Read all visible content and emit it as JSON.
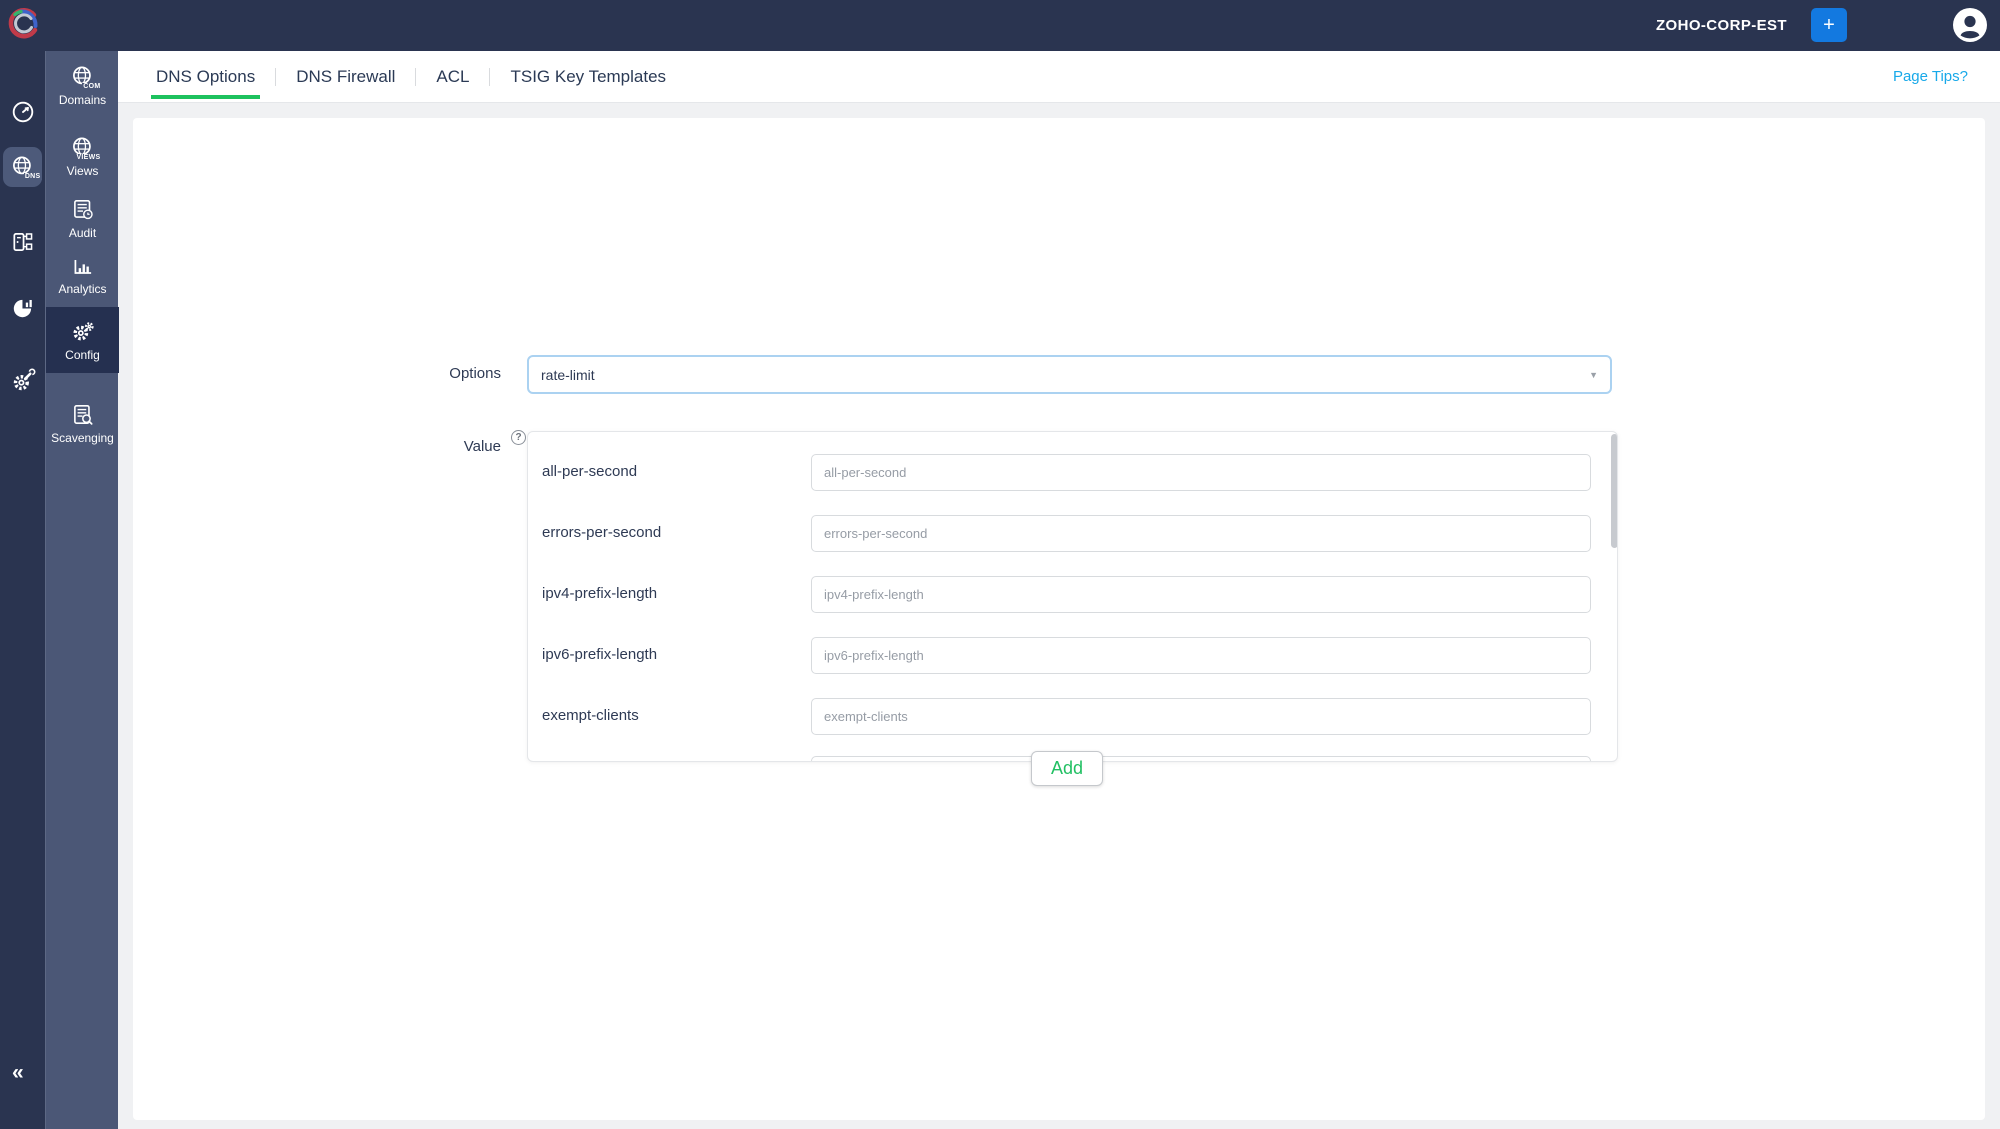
{
  "topbar": {
    "org_name": "ZOHO-CORP-EST",
    "add_label": "+"
  },
  "tab_bar": {
    "tabs": [
      {
        "label": "DNS Options",
        "active": true
      },
      {
        "label": "DNS Firewall",
        "active": false
      },
      {
        "label": "ACL",
        "active": false
      },
      {
        "label": "TSIG Key Templates",
        "active": false
      }
    ],
    "page_tips": "Page Tips?"
  },
  "primary_sidebar": {
    "icons": [
      "spiral-logo",
      "speedometer",
      "dns-globe",
      "server-network",
      "pie-chart",
      "gear-wrench"
    ],
    "selected": "dns-globe",
    "dns_badge": "DNS",
    "collapse": "«"
  },
  "secondary_sidebar": {
    "items": [
      {
        "label": "Domains",
        "icon": "globe-com",
        "badge": "COM",
        "active": false
      },
      {
        "label": "Views",
        "icon": "globe-views",
        "badge": "VIEWS",
        "active": false
      },
      {
        "label": "Audit",
        "icon": "document-clock",
        "active": false
      },
      {
        "label": "Analytics",
        "icon": "bar-chart",
        "active": false
      },
      {
        "label": "Config",
        "icon": "gears",
        "active": true
      },
      {
        "label": "Scavenging",
        "icon": "document-search",
        "active": false
      }
    ]
  },
  "form": {
    "options_label": "Options",
    "options_value": "rate-limit",
    "value_label": "Value",
    "help_icon": "?",
    "fields": [
      {
        "label": "all-per-second",
        "placeholder": "all-per-second"
      },
      {
        "label": "errors-per-second",
        "placeholder": "errors-per-second"
      },
      {
        "label": "ipv4-prefix-length",
        "placeholder": "ipv4-prefix-length"
      },
      {
        "label": "ipv6-prefix-length",
        "placeholder": "ipv6-prefix-length"
      },
      {
        "label": "exempt-clients",
        "placeholder": "exempt-clients"
      }
    ],
    "add_label": "Add"
  },
  "colors": {
    "accent_green": "#1dc25e",
    "link_blue": "#18a9e9",
    "button_blue": "#1379e0",
    "header_navy": "#2a3450",
    "sidebar_slate": "#4b5776"
  }
}
